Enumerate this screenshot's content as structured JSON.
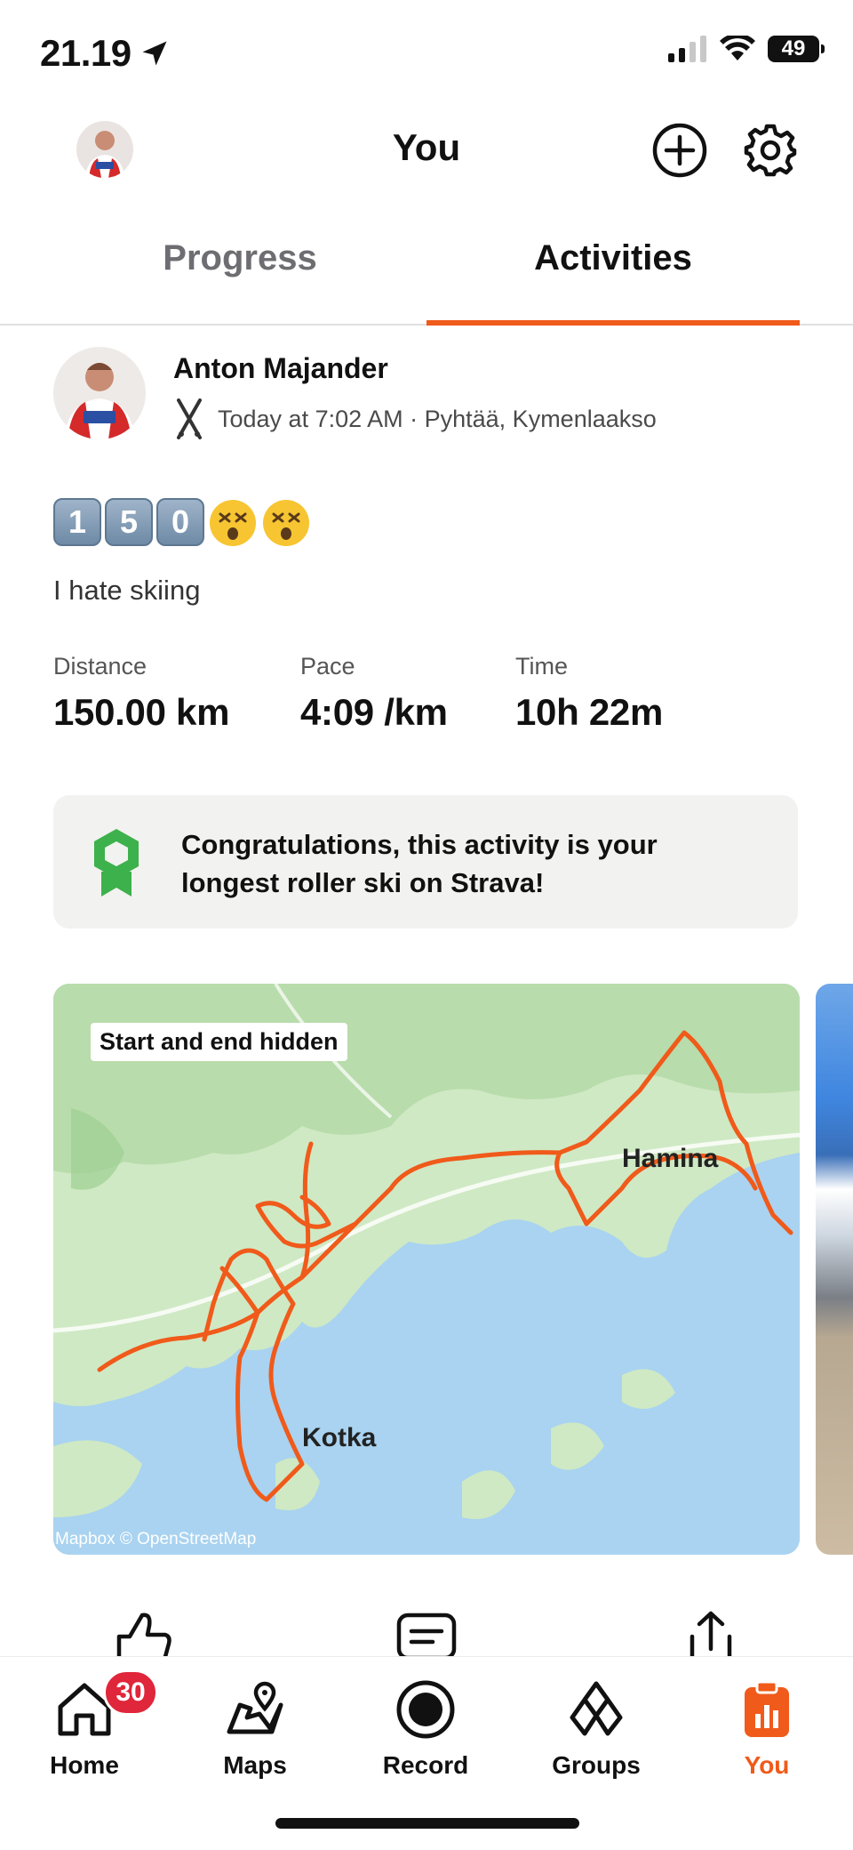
{
  "status_bar": {
    "time": "21.19",
    "battery": "49"
  },
  "header": {
    "title": "You"
  },
  "tabs": [
    {
      "label": "Progress",
      "active": false
    },
    {
      "label": "Activities",
      "active": true
    }
  ],
  "activity": {
    "athlete": "Anton Majander",
    "meta": "Today at 7:02 AM · Pyhtää, Kymenlaakso",
    "sport_icon": "roller-ski-icon",
    "title_keycaps": [
      "1",
      "5",
      "0"
    ],
    "title_emoji": [
      "dizzy-face",
      "dizzy-face"
    ],
    "description": "I hate skiing",
    "stats": [
      {
        "label": "Distance",
        "value": "150.00 km"
      },
      {
        "label": "Pace",
        "value": "4:09 /km"
      },
      {
        "label": "Time",
        "value": "10h 22m"
      }
    ],
    "achievement": "Congratulations, this activity is your longest roller ski on Strava!",
    "map": {
      "label": "Start and end hidden",
      "cities": [
        "Hamina",
        "Kotka"
      ],
      "attribution": "Mapbox © OpenStreetMap"
    },
    "actions": [
      "like-icon",
      "comment-icon",
      "share-icon"
    ]
  },
  "nav": {
    "items": [
      {
        "label": "Home",
        "icon": "home-icon",
        "badge": "30",
        "active": false
      },
      {
        "label": "Maps",
        "icon": "map-icon",
        "active": false
      },
      {
        "label": "Record",
        "icon": "record-icon",
        "active": false
      },
      {
        "label": "Groups",
        "icon": "groups-icon",
        "active": false
      },
      {
        "label": "You",
        "icon": "you-icon",
        "active": true
      }
    ]
  },
  "colors": {
    "accent": "#f05a1a",
    "badge": "#e0263a",
    "achievement_green": "#3db14b",
    "route": "#f05a1a"
  }
}
